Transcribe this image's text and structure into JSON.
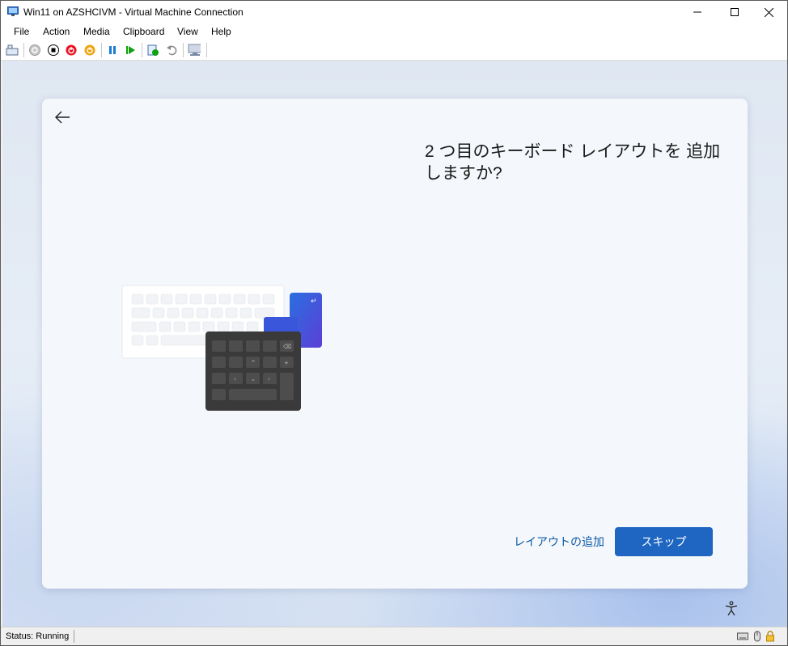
{
  "window": {
    "title": "Win11 on AZSHCIVM - Virtual Machine Connection",
    "controls": [
      "minimize",
      "maximize",
      "close"
    ]
  },
  "menu": [
    "File",
    "Action",
    "Media",
    "Clipboard",
    "View",
    "Help"
  ],
  "toolbar": {
    "icons": [
      "ctrl-alt-del-icon",
      "start-icon",
      "turn-off-icon",
      "shut-down-icon",
      "reset-icon",
      "pause-icon",
      "resume-icon",
      "checkpoint-icon",
      "revert-icon",
      "enhanced-session-icon"
    ]
  },
  "oobe": {
    "heading": "2 つ目のキーボード レイアウトを 追加しますか?",
    "add_layout_label": "レイアウトの追加",
    "skip_label": "スキップ"
  },
  "status": {
    "text": "Status: Running"
  },
  "colors": {
    "primary_button": "#1f66c2",
    "link": "#0c5aa6",
    "stop_red": "#e81123",
    "power_orange": "#f0a30a",
    "pause_blue": "#1c7bd6",
    "resume_green": "#10a010"
  }
}
